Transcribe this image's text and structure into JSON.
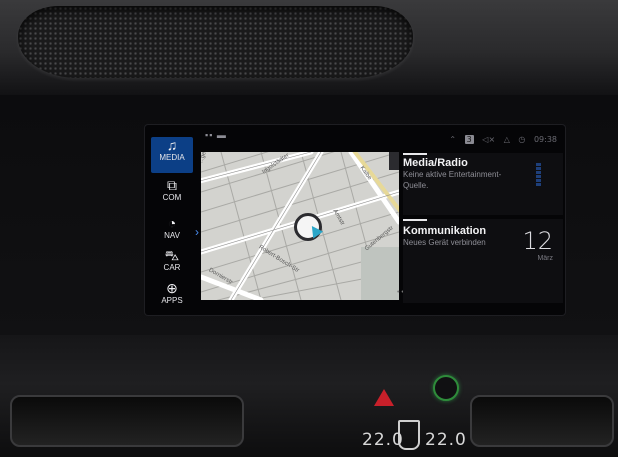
{
  "sidebar": {
    "items": [
      {
        "label": "MEDIA",
        "icon": "music-note-icon",
        "active": true
      },
      {
        "label": "COM",
        "icon": "phone-screen-icon",
        "active": false
      },
      {
        "label": "NAV",
        "icon": "navigation-icon",
        "active": false
      },
      {
        "label": "CAR",
        "icon": "car-icon",
        "active": false
      },
      {
        "label": "APPS",
        "icon": "apps-globe-icon",
        "active": false
      }
    ]
  },
  "status_bar": {
    "sim": "3",
    "time": "09:38"
  },
  "map": {
    "streets": [
      "Ingolstädter",
      "Robert-Bosch-Str",
      "Dornierstr",
      "Gutenbergstr",
      "Amtstr",
      "Kalbe",
      "...gesäure"
    ]
  },
  "media_widget": {
    "title": "Media/Radio",
    "subtitle": "Keine aktive Entertainment-Quelle."
  },
  "com_widget": {
    "title": "Kommunikation",
    "subtitle": "Neues Gerät verbinden",
    "day": "12",
    "month": "März"
  },
  "climate": {
    "left_temp": "22.0",
    "right_temp": "22.0"
  },
  "colors": {
    "accent": "#0c3f86",
    "chevron": "#4a8df0",
    "position_arrow": "#2aa6c8",
    "hazard": "#c8202a"
  }
}
